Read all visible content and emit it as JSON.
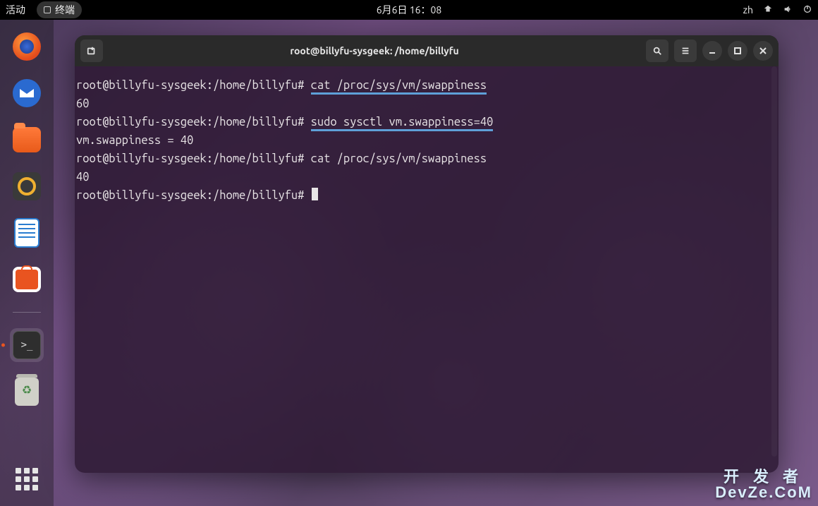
{
  "topbar": {
    "activities": "活动",
    "app_name": "终端",
    "datetime": "6月6日 16：08",
    "input_method": "zh"
  },
  "dock": {
    "items": [
      {
        "name": "firefox"
      },
      {
        "name": "thunderbird"
      },
      {
        "name": "files"
      },
      {
        "name": "rhythmbox"
      },
      {
        "name": "libreoffice-writer"
      },
      {
        "name": "ubuntu-software"
      },
      {
        "name": "terminal",
        "active": true
      },
      {
        "name": "trash"
      }
    ]
  },
  "terminal": {
    "title": "root@billyfu-sysgeek: /home/billyfu",
    "prompt": "root@billyfu-sysgeek:/home/billyfu#",
    "lines": [
      {
        "prompt": true,
        "cmd": "cat /proc/sys/vm/swappiness",
        "highlight": true
      },
      {
        "output": "60"
      },
      {
        "prompt": true,
        "cmd": "sudo sysctl vm.swappiness=40",
        "highlight": true
      },
      {
        "output": "vm.swappiness = 40"
      },
      {
        "prompt": true,
        "cmd": "cat /proc/sys/vm/swappiness",
        "highlight": false
      },
      {
        "output": "40"
      },
      {
        "prompt": true,
        "cmd": "",
        "cursor": true
      }
    ]
  },
  "watermark": {
    "line1": "开发者",
    "line2": "DevZe.CoM"
  }
}
